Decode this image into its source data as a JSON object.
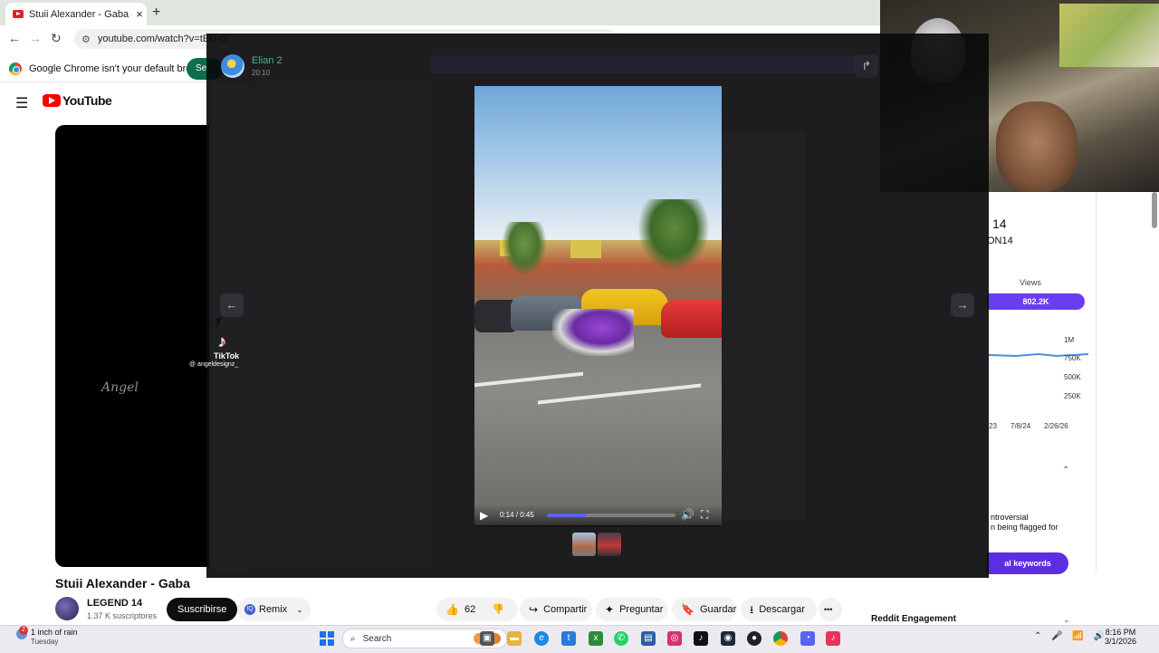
{
  "browser": {
    "tab_title": "Stuii Alexander - Gaba - YouTub",
    "new_tab": "+",
    "url": "youtube.com/watch?v=tEG-G",
    "infobar_text": "Google Chrome isn't your default browser",
    "infobar_button": "Se"
  },
  "youtube": {
    "logo_text": "YouTube",
    "video_title": "Stuii Alexander - Gaba",
    "channel_name": "LEGEND 14",
    "subscribers": "1.37 K suscriptores",
    "subscribe_label": "Suscribirse",
    "remix_label": "Remix",
    "like_count": "62",
    "share_label": "Compartir",
    "ask_label": "Preguntar",
    "save_label": "Guardar",
    "download_label": "Descargar",
    "more_label": "•••"
  },
  "sidebar_right": {
    "channel_short": "14",
    "channel_id": "ON14",
    "views_header": "Views",
    "views_value": "802.2K",
    "chart_y_ticks": [
      "1M",
      "750K",
      "500K",
      "250K"
    ],
    "chart_x_ticks": [
      "23",
      "7/8/24",
      "2/26/26"
    ],
    "flag_text_1": "ntroversial",
    "flag_text_2": "n being flagged for",
    "keywords_button": "al keywords",
    "reddit_label": "Reddit Engagement"
  },
  "discord_viewer": {
    "user_name": "Elian 2",
    "user_time": "20:10",
    "video": {
      "time_display": "0:14 / 0:45",
      "progress": 0.31,
      "tiktok_label": "TikTok",
      "tiktok_handle": "@ angeldesignz_",
      "watermark": "Angel"
    }
  },
  "taskbar": {
    "weather_badge": "2",
    "weather_text": "1 inch of rain",
    "weather_day": "Tuesday",
    "search_placeholder": "Search",
    "time": "8:16 PM",
    "date": "3/1/2026"
  },
  "colors": {
    "youtube_red": "#ff0000",
    "views_bar": "#6b3df0",
    "discord_accent": "#5865f2",
    "username_green": "#43b581"
  }
}
